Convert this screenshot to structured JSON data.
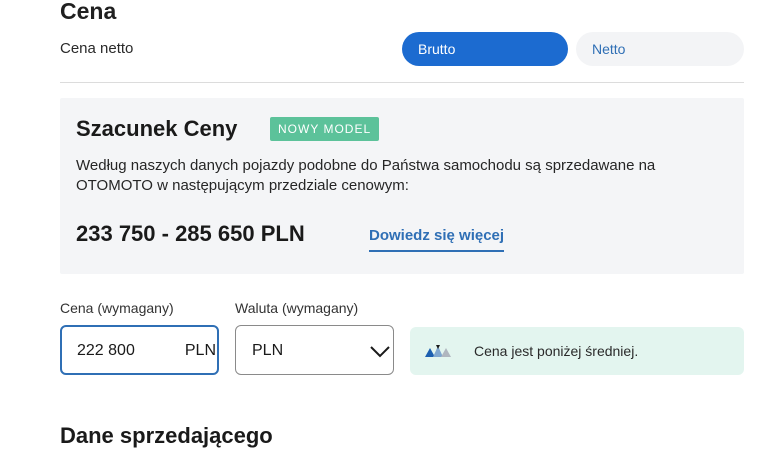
{
  "price_section": {
    "title": "Cena",
    "type_label": "Cena netto",
    "toggle": {
      "brutto": "Brutto",
      "netto": "Netto",
      "selected": "Brutto"
    }
  },
  "estimate": {
    "title": "Szacunek Ceny",
    "badge": "NOWY MODEL",
    "description": "Według naszych danych pojazdy podobne do Państwa samochodu są sprzedawane na OTOMOTO w następującym przedziale cenowym:",
    "range": "233 750 - 285 650 PLN",
    "learn_more": "Dowiedz się więcej"
  },
  "form": {
    "price_label": "Cena (wymagany)",
    "price_value": "222 800",
    "price_unit": "PLN",
    "currency_label": "Waluta (wymagany)",
    "currency_value": "PLN"
  },
  "indicator": {
    "text": "Cena jest poniżej średniej.",
    "icon": "price-gauge-icon"
  },
  "seller_section": {
    "title": "Dane sprzedającego"
  },
  "colors": {
    "primary": "#1c6bd0",
    "link": "#2f6fb5",
    "badge": "#5cc29a",
    "indicator_bg": "#e3f5ef"
  }
}
